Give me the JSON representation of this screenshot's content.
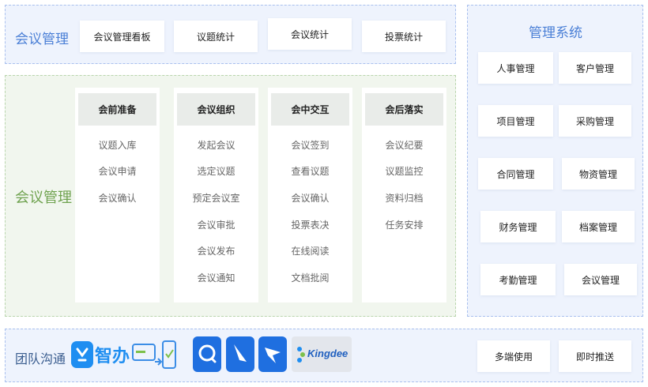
{
  "top": {
    "title": "会议管理",
    "items": [
      "会议管理看板",
      "议题统计",
      "会议统计",
      "投票统计"
    ]
  },
  "middle": {
    "title": "会议管理",
    "columns": [
      {
        "head": "会前准备",
        "items": [
          "议题入库",
          "会议申请",
          "会议确认"
        ]
      },
      {
        "head": "会议组织",
        "items": [
          "发起会议",
          "选定议题",
          "预定会议室",
          "会议审批",
          "会议发布",
          "会议通知"
        ]
      },
      {
        "head": "会中交互",
        "items": [
          "会议签到",
          "查看议题",
          "会议确认",
          "投票表决",
          "在线阅读",
          "文档批阅"
        ]
      },
      {
        "head": "会后落实",
        "items": [
          "会议纪要",
          "议题监控",
          "资料归档",
          "任务安排"
        ]
      }
    ]
  },
  "system": {
    "title": "管理系统",
    "items": [
      "人事管理",
      "客户管理",
      "项目管理",
      "采购管理",
      "合同管理",
      "物资管理",
      "财务管理",
      "档案管理",
      "考勤管理",
      "会议管理"
    ]
  },
  "bottom": {
    "title": "团队沟通",
    "zhiban_label": "智办",
    "kingdee_label": "Kingdee",
    "items": [
      "多端使用",
      "即时推送"
    ]
  },
  "colors": {
    "accent_blue": "#4a7fd6",
    "accent_green": "#6fa24f",
    "panel_blue": "#eef3fd",
    "panel_green": "#f1f6ee"
  }
}
